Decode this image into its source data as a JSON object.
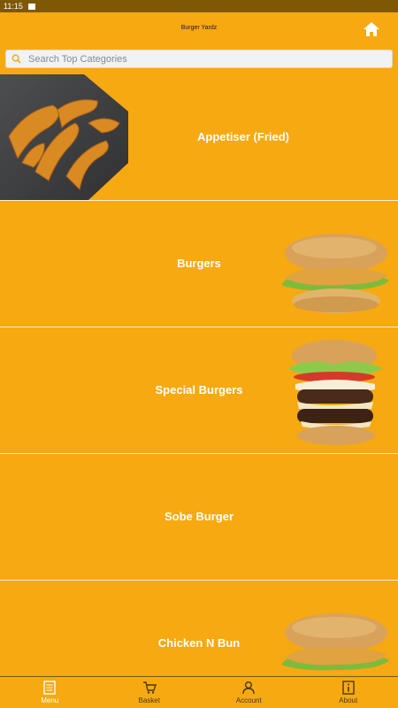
{
  "status_bar": {
    "time": "11:15"
  },
  "header": {
    "title": "Burger Yardz"
  },
  "search": {
    "placeholder": "Search Top Categories"
  },
  "categories": [
    {
      "label": "Appetiser (Fried)"
    },
    {
      "label": "Burgers"
    },
    {
      "label": "Special Burgers"
    },
    {
      "label": "Sobe Burger"
    },
    {
      "label": "Chicken N Bun"
    }
  ],
  "tabs": [
    {
      "label": "Menu",
      "icon": "menu-icon"
    },
    {
      "label": "Basket",
      "icon": "basket-icon"
    },
    {
      "label": "Account",
      "icon": "account-icon"
    },
    {
      "label": "About",
      "icon": "info-icon"
    }
  ],
  "colors": {
    "primary": "#F7A912",
    "status_bar": "#7F5806",
    "text": "#FFFFFF"
  }
}
